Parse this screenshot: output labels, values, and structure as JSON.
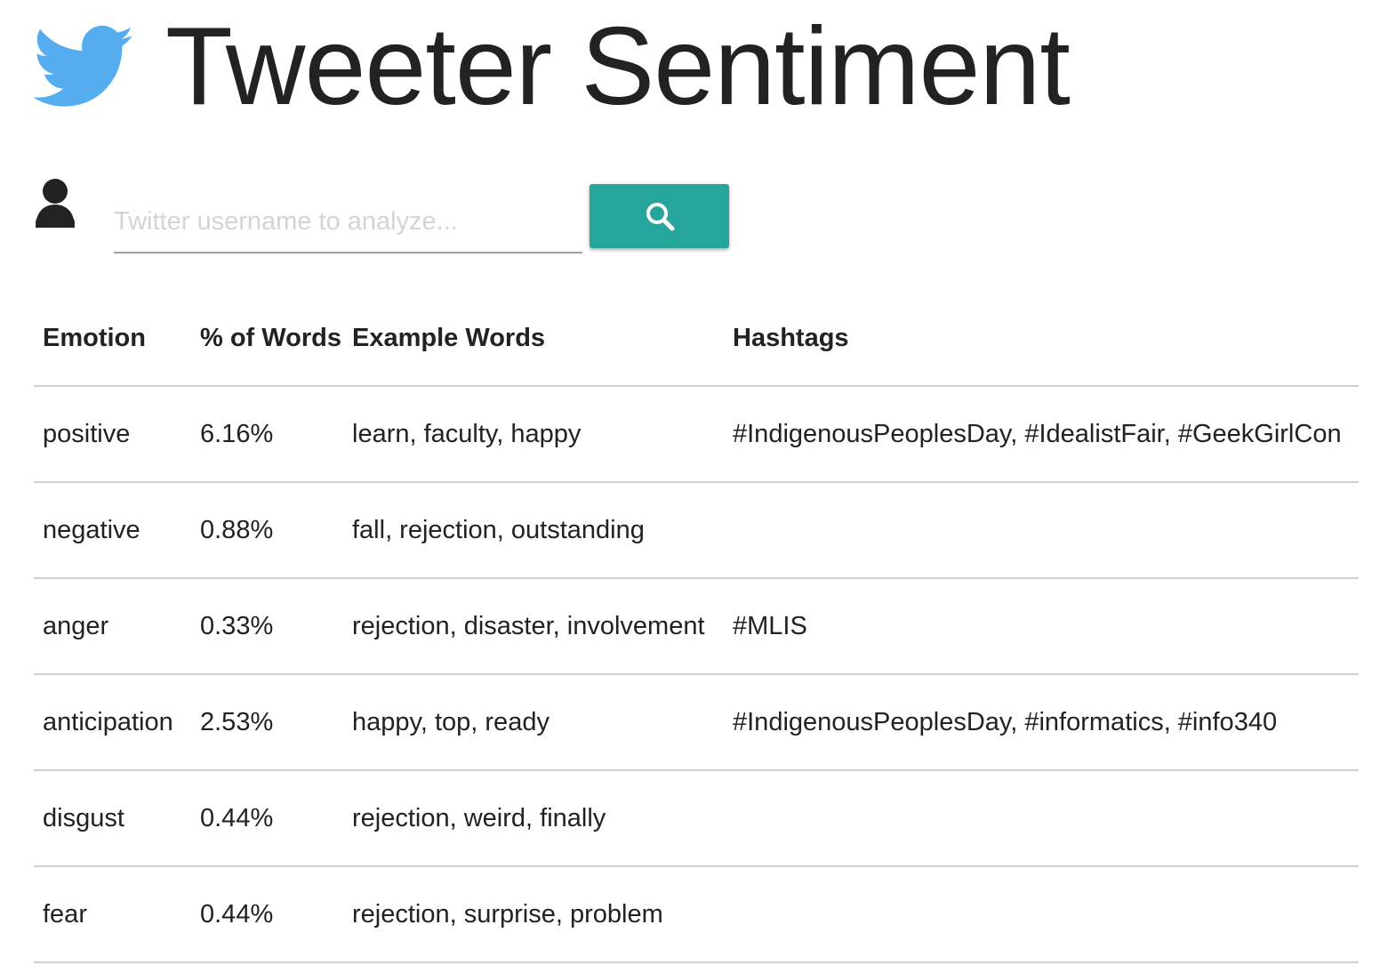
{
  "app": {
    "title": "Tweeter Sentiment",
    "logo_icon": "twitter-bird-icon",
    "brand_color": "#55acee"
  },
  "search": {
    "user_icon": "user-icon",
    "placeholder": "Twitter username to analyze...",
    "value": "",
    "button_icon": "search-icon",
    "button_color": "#26a69a"
  },
  "table": {
    "headers": {
      "emotion": "Emotion",
      "percent": "% of Words",
      "examples": "Example Words",
      "hashtags": "Hashtags"
    },
    "rows": [
      {
        "emotion": "positive",
        "percent": "6.16%",
        "examples": "learn, faculty, happy",
        "hashtags": "#IndigenousPeoplesDay, #IdealistFair, #GeekGirlCon"
      },
      {
        "emotion": "negative",
        "percent": "0.88%",
        "examples": "fall, rejection, outstanding",
        "hashtags": ""
      },
      {
        "emotion": "anger",
        "percent": "0.33%",
        "examples": "rejection, disaster, involvement",
        "hashtags": "#MLIS"
      },
      {
        "emotion": "anticipation",
        "percent": "2.53%",
        "examples": "happy, top, ready",
        "hashtags": "#IndigenousPeoplesDay, #informatics, #info340"
      },
      {
        "emotion": "disgust",
        "percent": "0.44%",
        "examples": "rejection, weird, finally",
        "hashtags": ""
      },
      {
        "emotion": "fear",
        "percent": "0.44%",
        "examples": "rejection, surprise, problem",
        "hashtags": ""
      }
    ]
  }
}
